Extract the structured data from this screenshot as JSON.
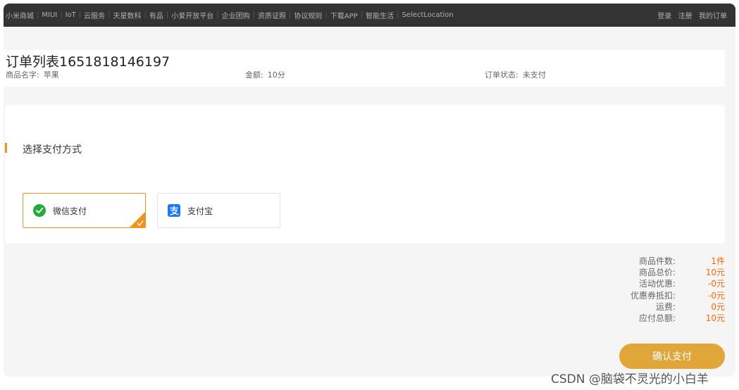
{
  "topbar": {
    "nav": [
      "小米商城",
      "MIUI",
      "IoT",
      "云服务",
      "天星数科",
      "有品",
      "小爱开放平台",
      "企业团购",
      "资质证照",
      "协议规则",
      "下载APP",
      "智能生活",
      "SelectLocation"
    ],
    "user": [
      "登录",
      "注册",
      "我的订单"
    ]
  },
  "order": {
    "title": "订单列表1651818146197",
    "product_label": "商品名字:",
    "product_value": "苹果",
    "amount_label": "金额:",
    "amount_value": "10分",
    "status_label": "订单状态:",
    "status_value": "未支付"
  },
  "payment": {
    "section_title": "选择支付方式",
    "options": [
      {
        "label": "微信支付",
        "icon": "wechat-pay-icon",
        "selected": true
      },
      {
        "label": "支付宝",
        "icon": "alipay-icon",
        "selected": false
      }
    ]
  },
  "summary": [
    {
      "label": "商品件数:",
      "value": "1件"
    },
    {
      "label": "商品总价:",
      "value": "10元"
    },
    {
      "label": "活动优惠:",
      "value": "-0元"
    },
    {
      "label": "优惠券抵扣:",
      "value": "-0元"
    },
    {
      "label": "运费:",
      "value": "0元"
    },
    {
      "label": "应付总额:",
      "value": "10元"
    }
  ],
  "confirm_label": "确认支付",
  "watermark": "CSDN @脑袋不灵光的小白羊",
  "colors": {
    "accent": "#f0931a",
    "price": "#ff6700",
    "button": "#e0a63a",
    "topbar": "#333333"
  }
}
